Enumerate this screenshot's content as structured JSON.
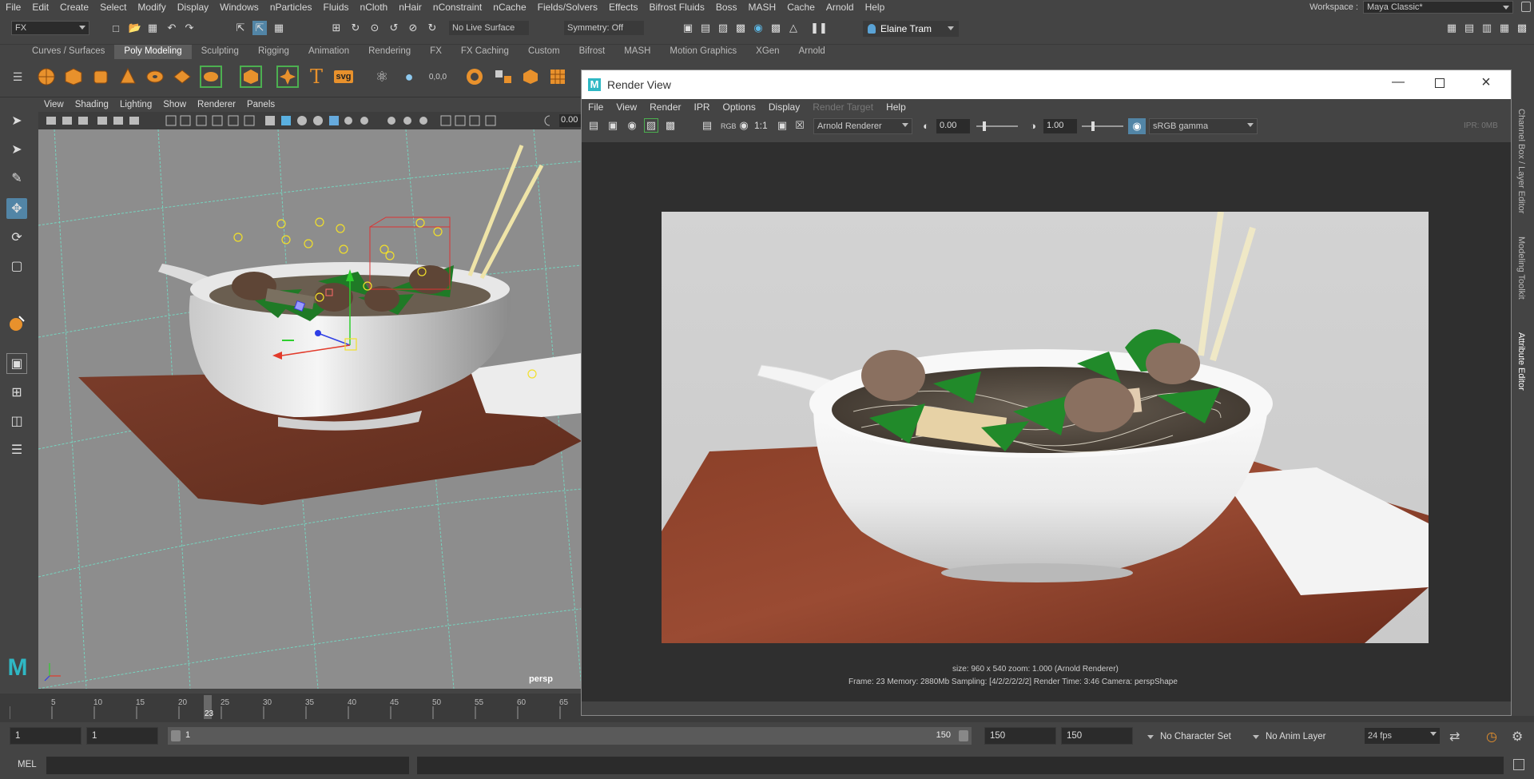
{
  "menubar": {
    "items": [
      "File",
      "Edit",
      "Create",
      "Select",
      "Modify",
      "Display",
      "Windows",
      "nParticles",
      "Fluids",
      "nCloth",
      "nHair",
      "nConstraint",
      "nCache",
      "Fields/Solvers",
      "Effects",
      "Bifrost Fluids",
      "Boss",
      "MASH",
      "Cache",
      "Arnold",
      "Help"
    ],
    "workspace_label": "Workspace :",
    "workspace_value": "Maya Classic*"
  },
  "statusline": {
    "menuset": "FX",
    "live_surface": "No Live Surface",
    "symmetry": "Symmetry: Off",
    "user": "Elaine Tram"
  },
  "shelf": {
    "tabs": [
      "Curves / Surfaces",
      "Poly Modeling",
      "Sculpting",
      "Rigging",
      "Animation",
      "Rendering",
      "FX",
      "FX Caching",
      "Custom",
      "Bifrost",
      "MASH",
      "Motion Graphics",
      "XGen",
      "Arnold"
    ],
    "active_tab": "Poly Modeling"
  },
  "viewport": {
    "menu": [
      "View",
      "Shading",
      "Lighting",
      "Show",
      "Renderer",
      "Panels"
    ],
    "exposure_value": "0.00",
    "camera_label": "persp"
  },
  "timeline": {
    "ticks": [
      "5",
      "10",
      "15",
      "20",
      "25",
      "30",
      "35",
      "40",
      "45",
      "50",
      "55",
      "60",
      "65"
    ],
    "current_frame": "23"
  },
  "range": {
    "start_field": "1",
    "playback_start": "1",
    "slider_start": "1",
    "slider_end": "150",
    "playback_end": "150",
    "end_field": "150",
    "character_set": "No Character Set",
    "anim_layer": "No Anim Layer",
    "fps": "24 fps"
  },
  "cmdline": {
    "label": "MEL"
  },
  "renderview": {
    "title": "Render View",
    "menu": [
      "File",
      "View",
      "Render",
      "IPR",
      "Options",
      "Display",
      "Render Target",
      "Help"
    ],
    "renderer": "Arnold Renderer",
    "ratio_label": "1:1",
    "rgb_label": "RGB",
    "exposure": "0.00",
    "gamma": "1.00",
    "colorspace": "sRGB gamma",
    "ipr_mem": "IPR: 0MB",
    "status_line1": "size: 960 x 540  zoom: 1.000     (Arnold Renderer)",
    "status_line2": "Frame: 23    Memory: 2880Mb    Sampling: [4/2/2/2/2/2]    Render Time: 3:46    Camera: perspShape"
  },
  "right_tabs": [
    "Channel Box / Layer Editor",
    "Modeling Toolkit",
    "Attribute Editor"
  ],
  "colors": {
    "accent": "#5285a6",
    "active_tool": "#5285a6",
    "maya_teal": "#2fb8c4"
  }
}
